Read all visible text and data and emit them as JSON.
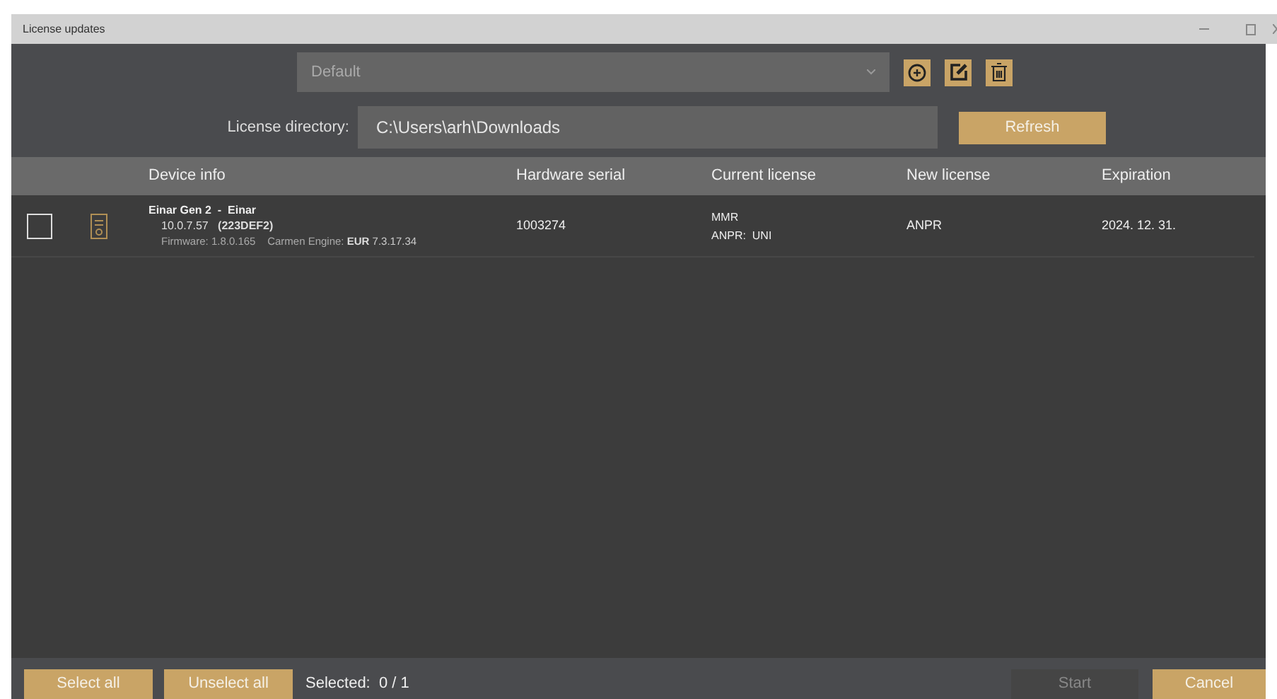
{
  "window": {
    "title": "License updates"
  },
  "profile": {
    "value": "Default"
  },
  "directory": {
    "label": "License directory:",
    "value": "C:\\Users\\arh\\Downloads",
    "refresh": "Refresh"
  },
  "table": {
    "columns": [
      "Device info",
      "Hardware serial",
      "Current license",
      "New license",
      "Expiration"
    ],
    "rows": [
      {
        "checked": false,
        "name": "Einar Gen 2  -  Einar",
        "version": "10.0.7.57",
        "code": "(223DEF2)",
        "firmware_label": "Firmware:",
        "firmware": "1.8.0.165",
        "engine_label": "Carmen Engine:",
        "engine_region": "EUR",
        "engine_version": "7.3.17.34",
        "serial": "1003274",
        "current_license": [
          "MMR",
          "ANPR:  UNI"
        ],
        "new_license": "ANPR",
        "expiration": "2024. 12. 31."
      }
    ]
  },
  "footer": {
    "select_all": "Select all",
    "unselect_all": "Unselect all",
    "selected_label": "Selected:",
    "selected_count": "0 / 1",
    "start": {
      "label": "Start",
      "disabled": true
    },
    "cancel": "Cancel"
  }
}
